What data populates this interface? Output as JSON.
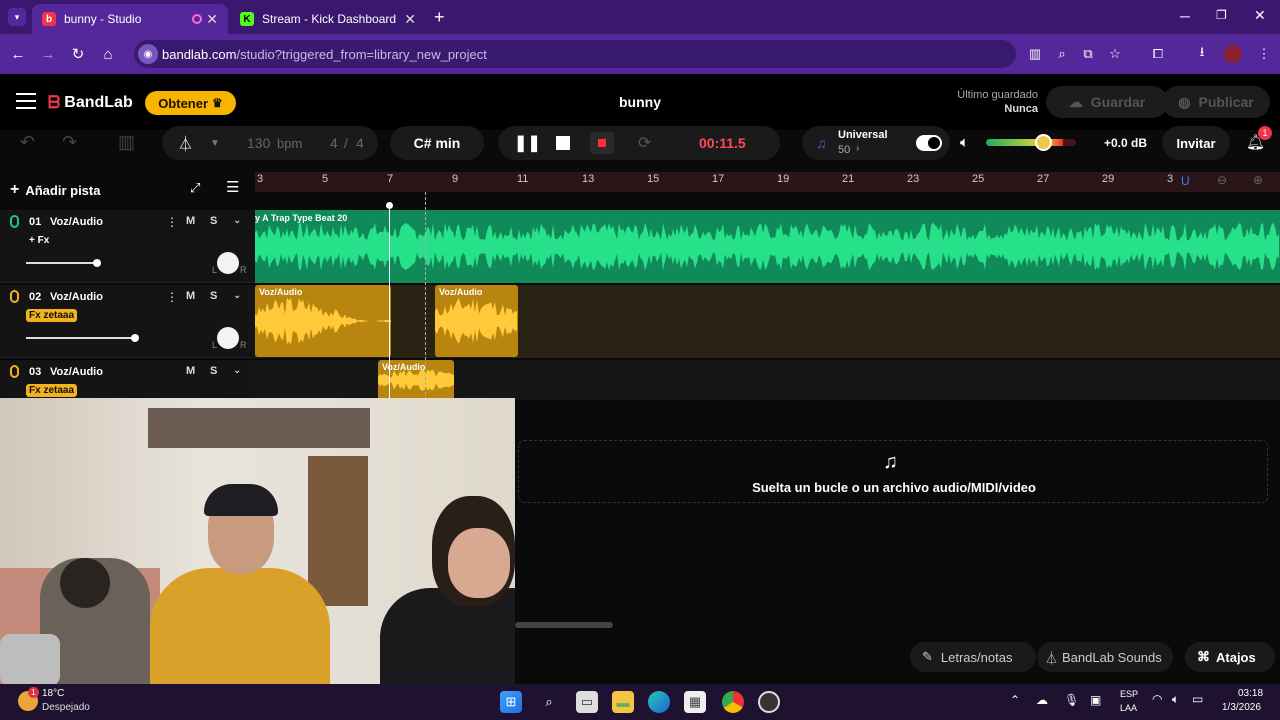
{
  "browser": {
    "tabs": [
      {
        "title": "bunny - Studio",
        "active": true,
        "icon": "bandlab-favicon"
      },
      {
        "title": "Stream - Kick Dashboard",
        "active": false,
        "icon": "kick-favicon"
      }
    ],
    "new_tab_symbol": "+",
    "url_host": "bandlab.com",
    "url_path": "/studio?triggered_from=library_new_project"
  },
  "studio": {
    "brand": "BandLab",
    "obtener_label": "Obtener",
    "project_title": "bunny",
    "saved_label": "Último guardado",
    "saved_value": "Nunca",
    "guardar_label": "Guardar",
    "publicar_label": "Publicar",
    "tempo_value": "130",
    "tempo_unit": "bpm",
    "time_sig_num": "4",
    "time_sig_den": "4",
    "key": "C# min",
    "time": "00:11.5",
    "preset_name": "Universal",
    "preset_value": "50",
    "master_db": "+0.0 dB",
    "invitar_label": "Invitar",
    "notification_count": "1",
    "add_track_label": "Añadir pista",
    "ruler_ticks": [
      "3",
      "5",
      "7",
      "9",
      "11",
      "13",
      "15",
      "17",
      "19",
      "21",
      "23",
      "25",
      "27",
      "29",
      "3"
    ],
    "tracks": [
      {
        "number": "01",
        "name": "Voz/Audio",
        "fx": "+ Fx",
        "mute": "M",
        "solo": "S",
        "color": "#20c97a"
      },
      {
        "number": "02",
        "name": "Voz/Audio",
        "fx": "Fx zetaaa",
        "mute": "M",
        "solo": "S",
        "color": "#f2b21e"
      },
      {
        "number": "03",
        "name": "Voz/Audio",
        "fx": "Fx zetaaa",
        "mute": "M",
        "solo": "S",
        "color": "#f2b21e"
      }
    ],
    "clips": {
      "track1_label": "y A  Trap Type Beat  20",
      "track2_clip1": "Voz/Audio",
      "track2_clip2": "Voz/Audio",
      "track3_clip1": "Voz/Audio"
    },
    "pan_l": "L",
    "pan_r": "R",
    "drop_text": "Suelta un bucle o un archivo audio/MIDI/video",
    "letras_label": "Letras/notas",
    "sounds_label": "BandLab Sounds",
    "atajos_label": "Atajos"
  },
  "taskbar": {
    "temperature": "18°C",
    "weather": "Despejado",
    "weather_badge": "1",
    "lang1": "ESP",
    "lang2": "LAA",
    "clock_time": "03:18",
    "clock_date": "1/3/2026"
  },
  "colors": {
    "browser_tabbar": "#3b1870",
    "browser_addrbar": "#54279a",
    "accent_yellow": "#f7b500",
    "record_red": "#ff4b57",
    "track_green": "#20c97a",
    "track_orange": "#f2b21e"
  }
}
